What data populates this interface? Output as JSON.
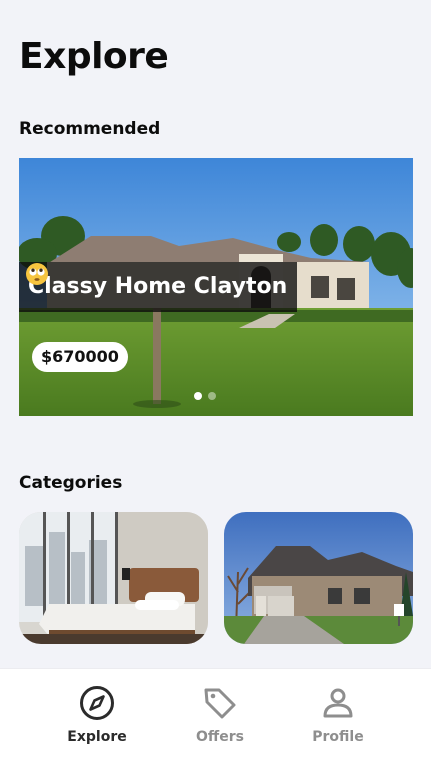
{
  "header": {
    "title": "Explore"
  },
  "recommended": {
    "section_title": "Recommended",
    "featured": {
      "title": "Classy Home Clayton",
      "price": "$670000",
      "emoji_icon": "face-with-rolling-eyes-emoji-icon",
      "carousel_dots": 2,
      "active_dot": 1
    }
  },
  "categories": {
    "section_title": "Categories",
    "cards": [
      {
        "image": "bedroom-photo"
      },
      {
        "image": "house-exterior-photo"
      }
    ]
  },
  "bottom_nav": {
    "items": [
      {
        "label": "Explore",
        "icon": "compass-icon",
        "active": true
      },
      {
        "label": "Offers",
        "icon": "tag-icon",
        "active": false
      },
      {
        "label": "Profile",
        "icon": "user-icon",
        "active": false
      }
    ]
  },
  "colors": {
    "background": "#f2f3f8",
    "nav_active": "#2b2b2b",
    "nav_inactive": "#8e8e8e",
    "overlay": "#0c0c0c"
  }
}
